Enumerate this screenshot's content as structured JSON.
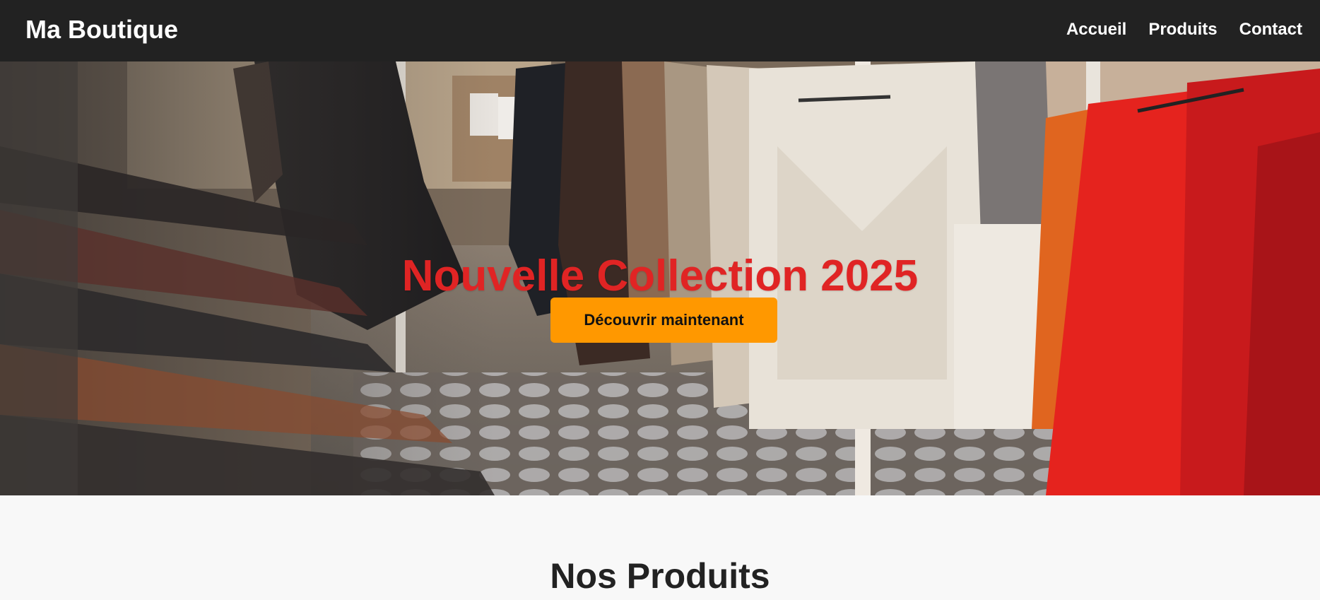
{
  "header": {
    "brand": "Ma Boutique",
    "nav": [
      {
        "label": "Accueil"
      },
      {
        "label": "Produits"
      },
      {
        "label": "Contact"
      }
    ]
  },
  "hero": {
    "title": "Nouvelle Collection 2025",
    "cta_label": "Découvrir maintenant",
    "title_color": "#e02424",
    "cta_color": "#ff9800"
  },
  "products": {
    "heading": "Nos Produits"
  }
}
